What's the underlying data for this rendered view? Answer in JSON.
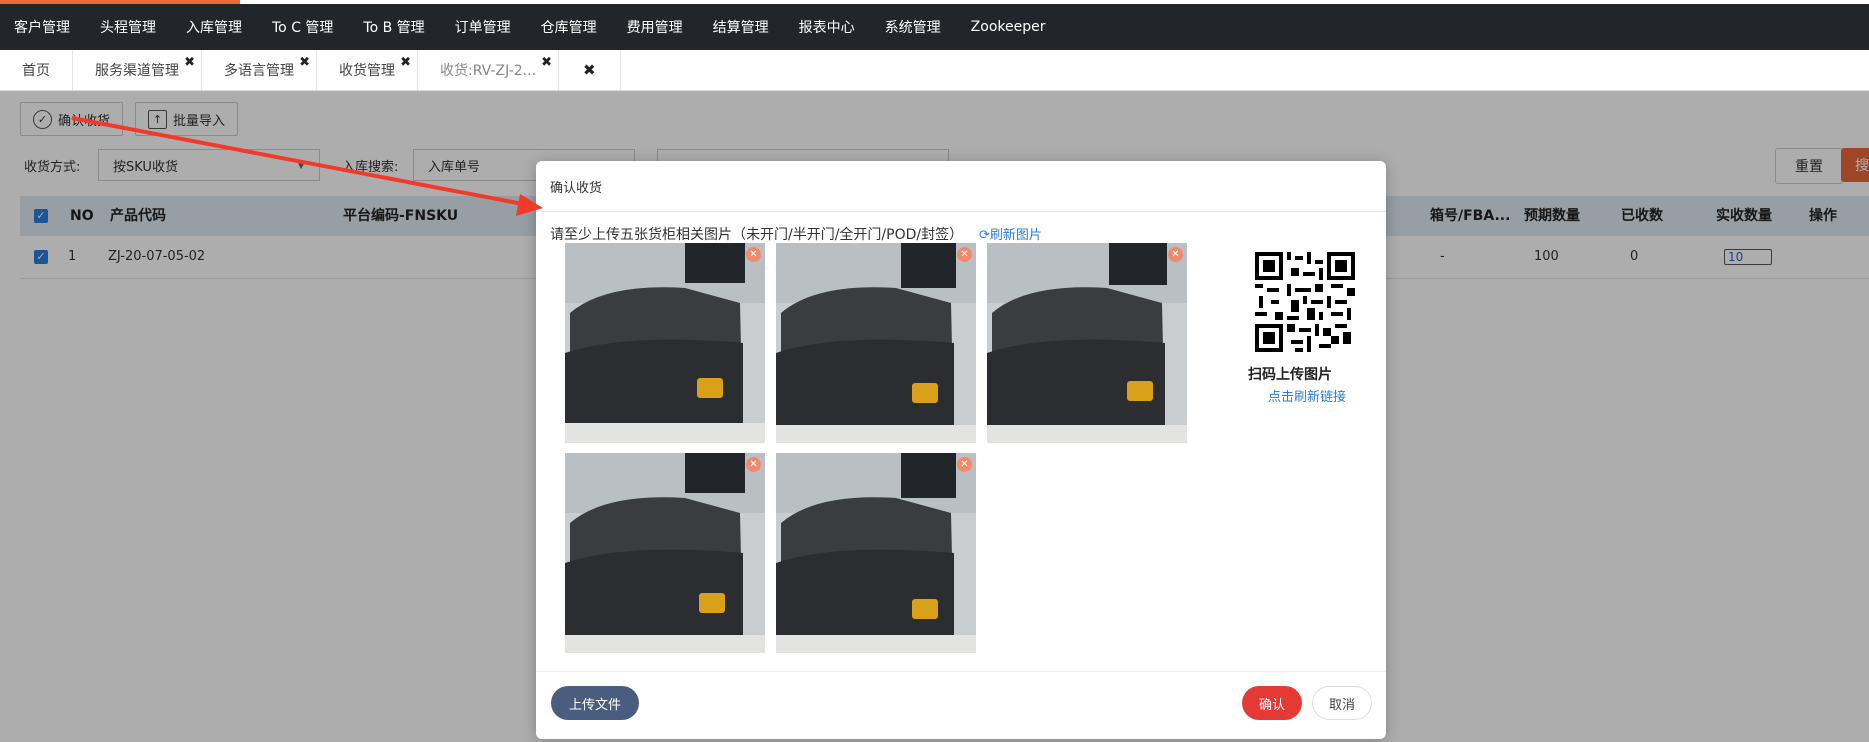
{
  "nav": {
    "items": [
      "客户管理",
      "头程管理",
      "入库管理",
      "To C 管理",
      "To B 管理",
      "订单管理",
      "仓库管理",
      "费用管理",
      "结算管理",
      "报表中心",
      "系统管理",
      "Zookeeper"
    ]
  },
  "tabs": [
    {
      "label": "首页",
      "closable": false
    },
    {
      "label": "服务渠道管理",
      "closable": true
    },
    {
      "label": "多语言管理",
      "closable": true
    },
    {
      "label": "收货管理",
      "closable": true
    },
    {
      "label": "收货:RV-ZJ-2...",
      "closable": true,
      "active": true
    }
  ],
  "toolbar": {
    "confirm_label": "确认收货",
    "import_label": "批量导入"
  },
  "filters": {
    "method_label": "收货方式:",
    "method_value": "按SKU收货",
    "search_label": "入库搜索:",
    "search_type": "入库单号",
    "reset_label": "重置",
    "search_label_btn": "搜"
  },
  "table": {
    "headers": [
      "NO",
      "产品代码",
      "平台编码-FNSKU",
      "箱号/FBA...",
      "预期数量",
      "已收数",
      "实收数量",
      "操作"
    ],
    "rows": [
      {
        "no": "1",
        "code": "ZJ-20-07-05-02",
        "box": "-",
        "expected": "100",
        "received": "0",
        "actual": "10"
      }
    ]
  },
  "modal": {
    "title": "确认收货",
    "hint": "请至少上传五张货柜相关图片（未开门/半开门/全开门/POD/封签）",
    "refresh_label": "刷新图片",
    "scan_label": "扫码上传图片",
    "scan_link": "点击刷新链接",
    "upload_label": "上传文件",
    "confirm_label": "确认",
    "cancel_label": "取消"
  },
  "colors": {
    "nav_bg": "#22262b",
    "accent": "#e8693a",
    "link": "#2a7de1",
    "confirm": "#e53935",
    "upload": "#4b5d7e",
    "arrow": "#f23a2a"
  }
}
